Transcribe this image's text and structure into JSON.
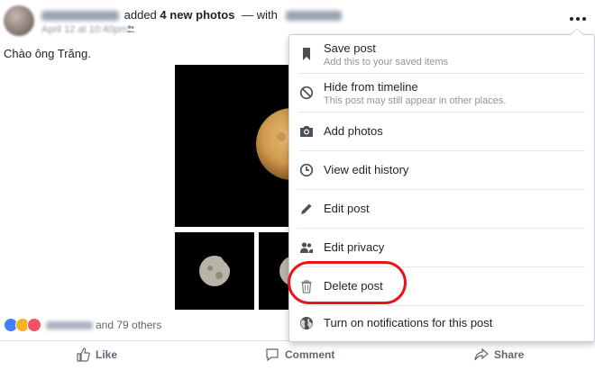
{
  "post": {
    "action_text": "added",
    "photos_count_text": "4 new photos",
    "with_text": "— with",
    "text": "Chào ông Trăng."
  },
  "reactions": {
    "others_text": "and 79 others"
  },
  "actions": {
    "like": "Like",
    "comment": "Comment",
    "share": "Share"
  },
  "menu": {
    "items": [
      {
        "label": "Save post",
        "sublabel": "Add this to your saved items",
        "icon": "bookmark-icon"
      },
      {
        "label": "Hide from timeline",
        "sublabel": "This post may still appear in other places.",
        "icon": "hide-icon"
      },
      {
        "label": "Add photos",
        "icon": "camera-icon"
      },
      {
        "label": "View edit history",
        "icon": "clock-icon"
      },
      {
        "label": "Edit post",
        "icon": "pencil-icon"
      },
      {
        "label": "Edit privacy",
        "icon": "people-icon"
      },
      {
        "label": "Delete post",
        "icon": "trash-icon",
        "highlighted": true
      },
      {
        "label": "Turn on notifications for this post",
        "icon": "globe-icon"
      }
    ]
  },
  "colors": {
    "link": "#4267b2",
    "highlight": "#e8141b",
    "moon": "#d9a35a"
  }
}
